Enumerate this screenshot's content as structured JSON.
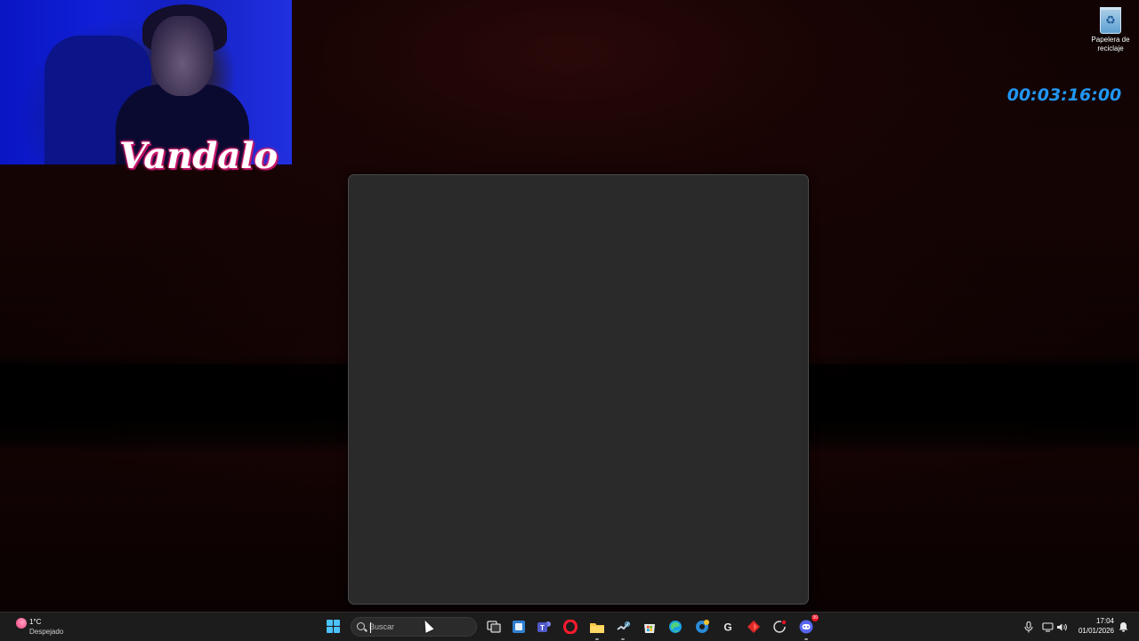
{
  "overlay": {
    "streamer_name": "Vandalo",
    "timer": "00:03:16:00"
  },
  "desktop": {
    "recycle_bin_label_line1": "Papelera de",
    "recycle_bin_label_line2": "reciclaje"
  },
  "taskbar": {
    "weather": {
      "temperature": "1°C",
      "condition": "Despejado",
      "icon": "sun-icon"
    },
    "search": {
      "placeholder": "Buscar",
      "value": ""
    },
    "apps": [
      {
        "name": "task-view",
        "icon": "task-view-icon"
      },
      {
        "name": "widgets",
        "icon": "widgets-icon"
      },
      {
        "name": "teams",
        "icon": "teams-icon",
        "glyph": "T",
        "color": "#6264a7"
      },
      {
        "name": "opera",
        "icon": "opera-icon",
        "glyph": "O",
        "color": "#ff1b2d"
      },
      {
        "name": "file-explorer",
        "icon": "folder-icon",
        "color": "#f8c84a"
      },
      {
        "name": "steam",
        "icon": "steam-icon",
        "color": "#1b2838"
      },
      {
        "name": "microsoft-store",
        "icon": "store-icon"
      },
      {
        "name": "edge",
        "icon": "edge-icon"
      },
      {
        "name": "edge-beta",
        "icon": "edge-beta-icon"
      },
      {
        "name": "app-g",
        "icon": "g-app-icon",
        "glyph": "G"
      },
      {
        "name": "app-diamond",
        "icon": "diamond-app-icon",
        "glyph": "◆",
        "color": "#e03030"
      },
      {
        "name": "app-circle",
        "icon": "circle-app-icon"
      },
      {
        "name": "discord",
        "icon": "discord-icon",
        "color": "#5865f2",
        "badge": "99"
      }
    ],
    "tray": {
      "time": "17:04",
      "date": "01/01/2026"
    }
  }
}
